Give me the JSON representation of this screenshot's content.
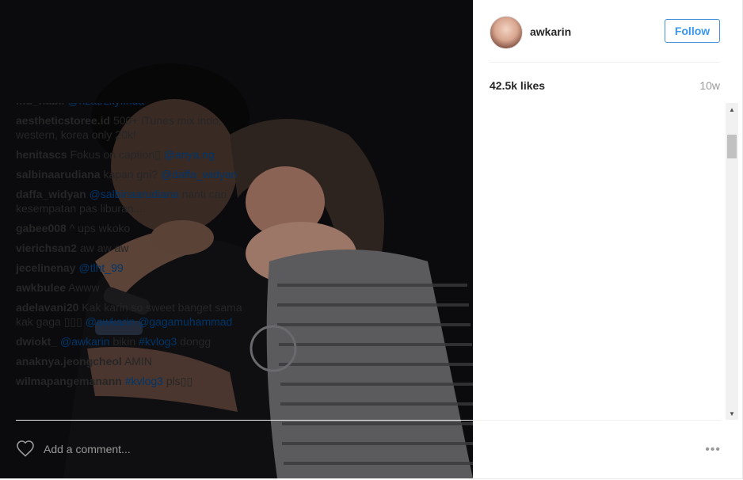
{
  "post": {
    "username": "awkarin",
    "follow_label": "Follow",
    "likes": "42.5k likes",
    "time_ago": "10w"
  },
  "comments": [
    {
      "user": "mu_nabil",
      "text": "",
      "mention": "@nzatrzkyfinda"
    },
    {
      "user": "aestheticstoree.id",
      "text": "500+ iTunes mix indo, western, korea only 20k!",
      "mention": ""
    },
    {
      "user": "henitascs",
      "text": "Fokus on caption▯",
      "mention": "@anya.ng"
    },
    {
      "user": "salbinaarudiana",
      "text": "kapan gni?",
      "mention": "@daffa_widyan"
    },
    {
      "user": "daffa_widyan",
      "text": "",
      "mention": "@salbinaarudiana",
      "after": "nanti cari kesempatan pas liburan...."
    },
    {
      "user": "gabee008",
      "text": "^ ups wkoko",
      "mention": ""
    },
    {
      "user": "vierichsan2",
      "text": "aw aw aw",
      "mention": ""
    },
    {
      "user": "jecelinenay",
      "text": "",
      "mention": "@tlht_99"
    },
    {
      "user": "awkbulee",
      "text": "Awww",
      "mention": ""
    },
    {
      "user": "adelavani20",
      "text": "Kak karin so sweet banget sama kak gaga ▯▯▯",
      "mention": "@awkarin",
      "mention2": "@gagamuhammad"
    },
    {
      "user": "dwiokt_",
      "text": "",
      "mention": "@awkarin",
      "after": "bikin",
      "mention2": "#kvlog3",
      "after2": "dongg"
    },
    {
      "user": "anaknya.jeongcheol",
      "text": "AMIN",
      "mention": ""
    },
    {
      "user": "wilmapangemanann",
      "text": "",
      "mention": "#kvlog3",
      "after": "pls▯▯"
    }
  ],
  "footer": {
    "comment_placeholder": "Add a comment...",
    "more_label": "•••"
  },
  "icons": {
    "heart": "heart-icon",
    "more": "more-options-icon",
    "scroll_up": "scroll-up-icon",
    "scroll_down": "scroll-down-icon"
  },
  "colors": {
    "follow_blue": "#3897f0",
    "mention": "#003569",
    "muted": "#999999"
  }
}
